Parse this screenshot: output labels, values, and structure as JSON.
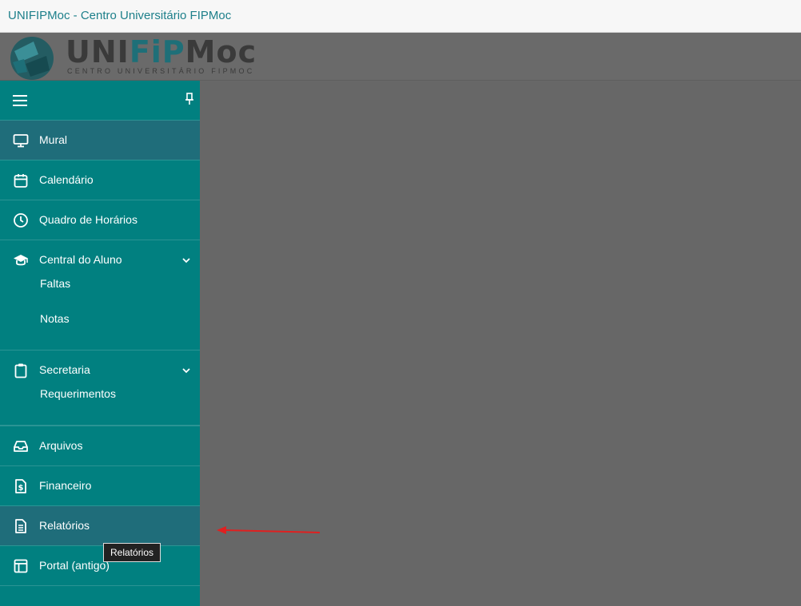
{
  "window": {
    "title": "UNIFIPMoc - Centro Universitário FIPMoc"
  },
  "logo": {
    "word_a": "UNI",
    "word_b": "FiP",
    "word_c": "Moc",
    "subtitle": "CENTRO UNIVERSITÁRIO FIPMOC",
    "colors": {
      "mark": "#1e6f78",
      "text": "#3a3a3a"
    }
  },
  "sidebar": {
    "bg_color": "#018080",
    "active_color": "#1f6d7a",
    "items": [
      {
        "label": "Mural",
        "icon": "monitor-icon"
      },
      {
        "label": "Calendário",
        "icon": "calendar-icon"
      },
      {
        "label": "Quadro de Horários",
        "icon": "clock-icon"
      },
      {
        "label": "Central do Aluno",
        "icon": "graduation-cap-icon",
        "children": [
          "Faltas",
          "Notas"
        ]
      },
      {
        "label": "Secretaria",
        "icon": "clipboard-icon",
        "children": [
          "Requerimentos"
        ]
      },
      {
        "label": "Arquivos",
        "icon": "inbox-icon"
      },
      {
        "label": "Financeiro",
        "icon": "dollar-file-icon"
      },
      {
        "label": "Relatórios",
        "icon": "document-icon"
      },
      {
        "label": "Portal (antigo)",
        "icon": "layout-icon"
      }
    ]
  },
  "tooltip": {
    "text": "Relatórios"
  },
  "annotation": {
    "color": "#e02020",
    "icon": "arrow-left-icon"
  }
}
